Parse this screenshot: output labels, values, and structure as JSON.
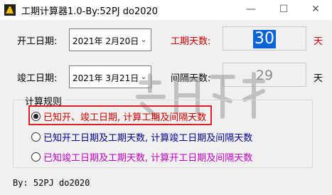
{
  "window": {
    "title": "工期计算器1.0-By:52PJ do2020",
    "minimize": "—",
    "maximize": "☐",
    "close": "✕"
  },
  "start_date": {
    "label": "开工日期:",
    "value": "2021年  2月20日"
  },
  "end_date": {
    "label": "竣工日期:",
    "value": "2021年  3月21日"
  },
  "duration": {
    "label": "工期天数:",
    "value": "30",
    "unit": "天"
  },
  "interval": {
    "label": "间隔天数:",
    "value": "29",
    "unit": "天"
  },
  "rules": {
    "title": "计算规则",
    "options": [
      {
        "label": "已知开、竣工日期, 计算工期及间隔天数",
        "checked": true,
        "color": "#cc0000"
      },
      {
        "label": "已知开工日期及工期天数, 计算竣工日期及间隔天数",
        "checked": false,
        "color": "#00008b"
      },
      {
        "label": "已知竣工日期及工期天数, 计算开工日期及间隔天数",
        "checked": false,
        "color": "#c000c0"
      }
    ]
  },
  "footer": "By: 52PJ  do2020",
  "colors": {
    "accent_red": "#cc0000",
    "selection_blue": "#0a64d8",
    "highlight_box": "#e02020"
  }
}
